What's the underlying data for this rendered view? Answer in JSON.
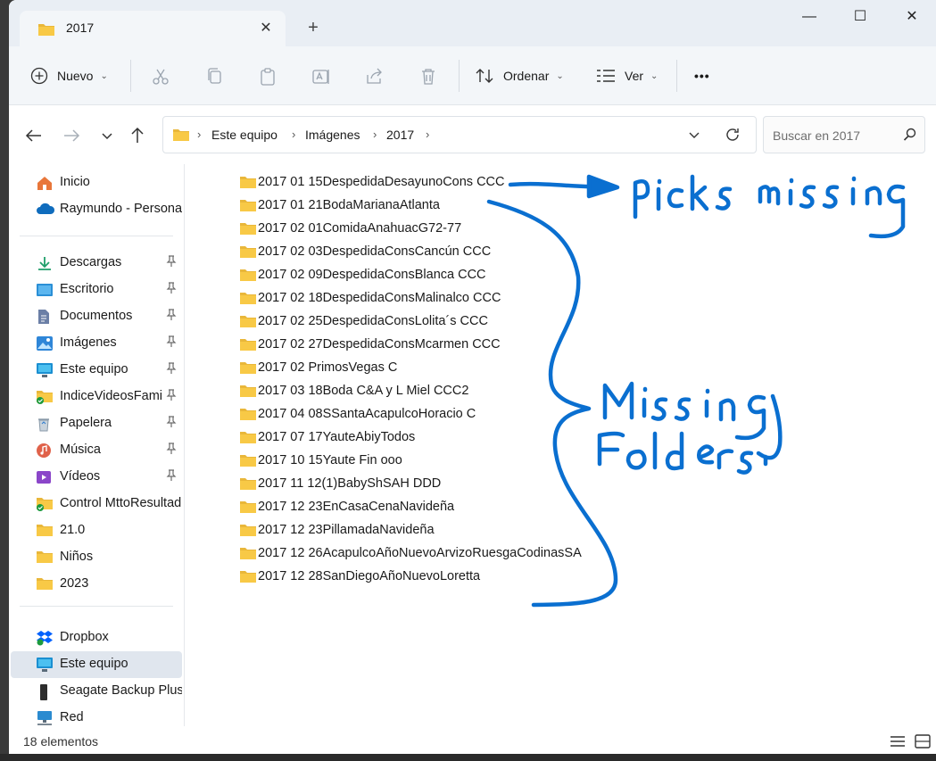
{
  "tab": {
    "title": "2017",
    "close": "✕",
    "new": "+"
  },
  "window_controls": {
    "minimize": "—",
    "maximize": "☐",
    "close": "✕"
  },
  "toolbar": {
    "new_label": "Nuevo",
    "sort_label": "Ordenar",
    "view_label": "Ver",
    "more_label": "•••"
  },
  "address": {
    "crumbs": [
      "Este equipo",
      "Imágenes",
      "2017"
    ],
    "search_placeholder": "Buscar en 2017"
  },
  "sidebar": {
    "items": [
      {
        "label": "Inicio",
        "icon": "home-icon"
      },
      {
        "label": "Raymundo - Persona",
        "icon": "onedrive-cloud-icon"
      },
      {
        "label": "Descargas",
        "icon": "download-icon",
        "pinned": true
      },
      {
        "label": "Escritorio",
        "icon": "desktop-icon",
        "pinned": true
      },
      {
        "label": "Documentos",
        "icon": "document-icon",
        "pinned": true
      },
      {
        "label": "Imágenes",
        "icon": "pictures-icon",
        "pinned": true
      },
      {
        "label": "Este equipo",
        "icon": "computer-icon",
        "pinned": true
      },
      {
        "label": "IndiceVideosFami",
        "icon": "folder-synced-icon",
        "pinned": true
      },
      {
        "label": "Papelera",
        "icon": "recycle-bin-icon",
        "pinned": true
      },
      {
        "label": "Música",
        "icon": "music-icon",
        "pinned": true
      },
      {
        "label": "Vídeos",
        "icon": "videos-icon",
        "pinned": true
      },
      {
        "label": "Control MttoResultad",
        "icon": "folder-synced-icon"
      },
      {
        "label": "21.0",
        "icon": "folder-icon"
      },
      {
        "label": "Niños",
        "icon": "folder-icon"
      },
      {
        "label": "2023",
        "icon": "folder-icon"
      },
      {
        "label": "Dropbox",
        "icon": "dropbox-icon"
      },
      {
        "label": "Este equipo",
        "icon": "computer-icon",
        "selected": true
      },
      {
        "label": "Seagate Backup Plus",
        "icon": "drive-icon"
      },
      {
        "label": "Red",
        "icon": "network-icon"
      }
    ],
    "pin_glyph": "📌"
  },
  "folders": [
    "2017 01 15DespedidaDesayunoCons CCC",
    "2017 01 21BodaMarianaAtlanta",
    "2017 02 01ComidaAnahuacG72-77",
    "2017 02 03DespedidaConsCancún CCC",
    "2017 02 09DespedidaConsBlanca CCC",
    "2017 02 18DespedidaConsMalinalco CCC",
    "2017 02 25DespedidaConsLolita´s CCC",
    "2017 02 27DespedidaConsMcarmen CCC",
    "2017 02 PrimosVegas C",
    "2017 03 18Boda C&A y L Miel CCC2",
    "2017 04 08SSantaAcapulcoHoracio C",
    "2017 07 17YauteAbiyTodos",
    "2017 10 15Yaute Fin ooo",
    "2017 11 12(1)BabyShSAH DDD",
    "2017 12 23EnCasaCenaNavideña",
    "2017 12 23PillamadaNavideña",
    "2017 12 26AcapulcoAñoNuevoArvizoRuesgaCodinasSA",
    "2017 12 28SanDiegoAñoNuevoLoretta"
  ],
  "status": {
    "count": "18 elementos"
  },
  "colors": {
    "accent": "#0067c0",
    "annotation_ink": "#0a6fd0",
    "folder": "#f8c946"
  }
}
